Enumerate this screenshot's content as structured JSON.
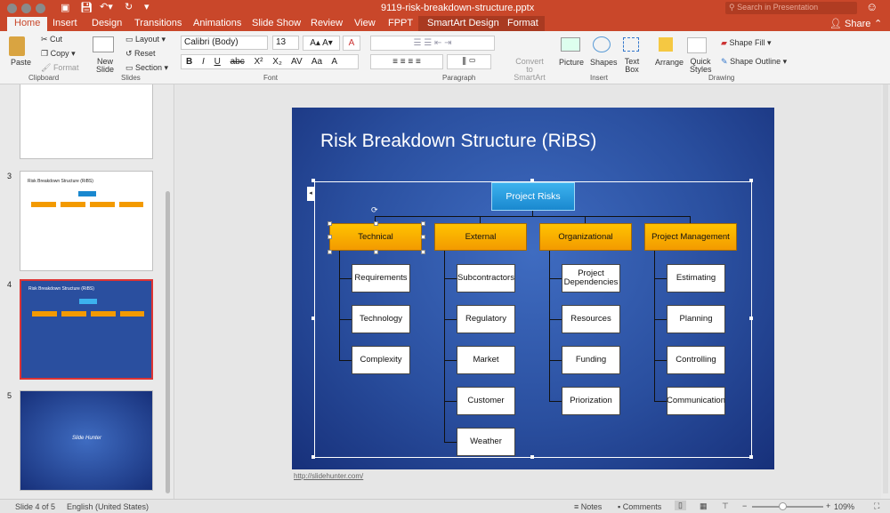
{
  "window": {
    "title": "9119-risk-breakdown-structure.pptx",
    "search_placeholder": "Search in Presentation"
  },
  "tabs": [
    "Home",
    "Insert",
    "Design",
    "Transitions",
    "Animations",
    "Slide Show",
    "Review",
    "View",
    "FPPT",
    "SmartArt Design",
    "Format"
  ],
  "share": "Share",
  "ribbon": {
    "clipboard": {
      "paste": "Paste",
      "cut": "Cut",
      "copy": "Copy",
      "format": "Format",
      "label": "Clipboard"
    },
    "slides": {
      "new_slide": "New Slide",
      "layout": "Layout",
      "reset": "Reset",
      "section": "Section",
      "label": "Slides"
    },
    "font": {
      "name": "Calibri (Body)",
      "size": "13",
      "label": "Font",
      "bold": "B",
      "italic": "I",
      "underline": "U",
      "strike": "abc"
    },
    "paragraph": {
      "label": "Paragraph",
      "convert": "Convert to SmartArt"
    },
    "insert": {
      "picture": "Picture",
      "shapes": "Shapes",
      "textbox": "Text Box",
      "label": "Insert"
    },
    "drawing": {
      "arrange": "Arrange",
      "quick_styles": "Quick Styles",
      "shape_fill": "Shape Fill",
      "shape_outline": "Shape Outline",
      "label": "Drawing"
    }
  },
  "thumbnails": [
    {
      "num": "3",
      "title": "Risk Breakdown Structure (RiBS)"
    },
    {
      "num": "4",
      "title": "Risk Breakdown Structure (RiBS)",
      "selected": true
    },
    {
      "num": "5",
      "title": "Slide Hunter"
    }
  ],
  "slide": {
    "title": "Risk Breakdown Structure (RiBS)",
    "root": "Project Risks",
    "categories": [
      {
        "name": "Technical",
        "children": [
          "Requirements",
          "Technology",
          "Complexity"
        ]
      },
      {
        "name": "External",
        "children": [
          "Subcontractors",
          "Regulatory",
          "Market",
          "Customer",
          "Weather"
        ]
      },
      {
        "name": "Organizational",
        "children": [
          "Project Dependencies",
          "Resources",
          "Funding",
          "Priorization"
        ]
      },
      {
        "name": "Project Management",
        "children": [
          "Estimating",
          "Planning",
          "Controlling",
          "Communication"
        ]
      }
    ],
    "footer_link": "http://slidehunter.com/"
  },
  "status": {
    "slide": "Slide 4 of 5",
    "language": "English (United States)",
    "notes": "Notes",
    "comments": "Comments",
    "zoom": "109%"
  },
  "colors": {
    "accent": "#c9472a",
    "root": "#1a88cf",
    "category": "#f39a00",
    "slide_bg": "#2a4f9f"
  }
}
